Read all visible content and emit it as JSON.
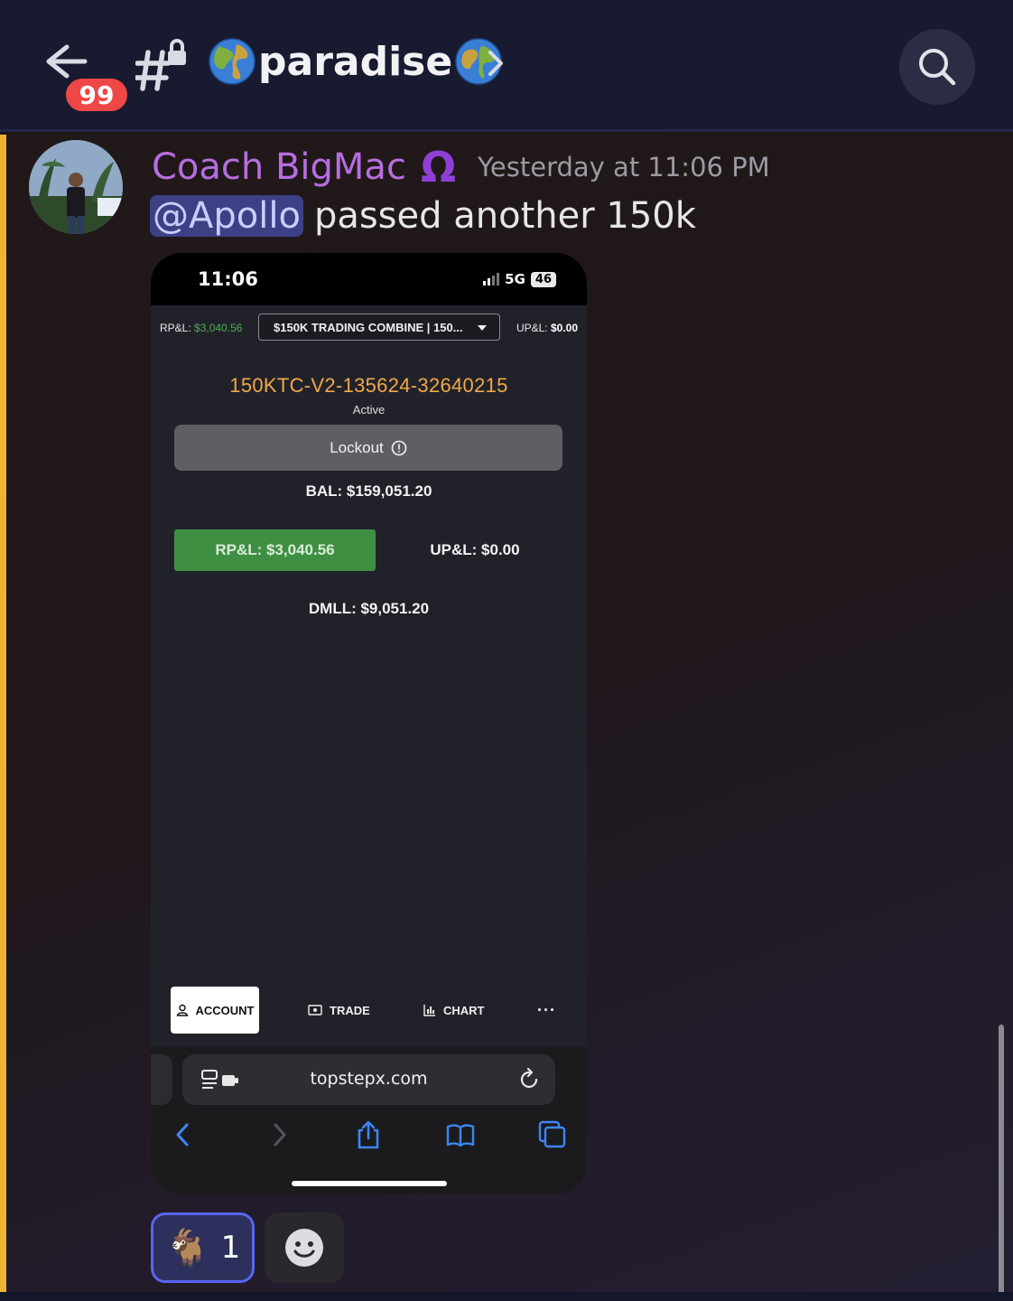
{
  "header": {
    "unread_badge": "99",
    "channel_name": "paradise",
    "globe_emoji": "🌍"
  },
  "message": {
    "author": "Coach BigMac",
    "author_role_icon": "Ω",
    "timestamp": "Yesterday at 11:06 PM",
    "mention": "@Apollo",
    "text": "passed another 150k"
  },
  "screenshot": {
    "status": {
      "time": "11:06",
      "network": "5G",
      "battery": "46"
    },
    "topbar": {
      "rpl_label": "RP&L:",
      "rpl_value": "$3,040.56",
      "combine_select": "$150K TRADING COMBINE  |  150...",
      "upl_label": "UP&L:",
      "upl_value": "$0.00"
    },
    "account_id": "150KTC-V2-135624-32640215",
    "account_status": "Active",
    "lockout_label": "Lockout",
    "balance": "BAL: $159,051.20",
    "rpl_box": "RP&L: $3,040.56",
    "upl_big": "UP&L: $0.00",
    "dmll": "DMLL: $9,051.20",
    "nav": {
      "account": "ACCOUNT",
      "trade": "TRADE",
      "chart": "CHART",
      "more": "···"
    },
    "url": "topstepx.com"
  },
  "reactions": [
    {
      "emoji": "🐐",
      "count": "1"
    }
  ],
  "colors": {
    "accent_highlight": "#f0b232",
    "author": "#b66ee0",
    "mention_bg": "#3c4185",
    "reaction_border": "#5865f2",
    "rpl_green": "#3f8f43",
    "account_id_orange": "#f0a84a"
  }
}
